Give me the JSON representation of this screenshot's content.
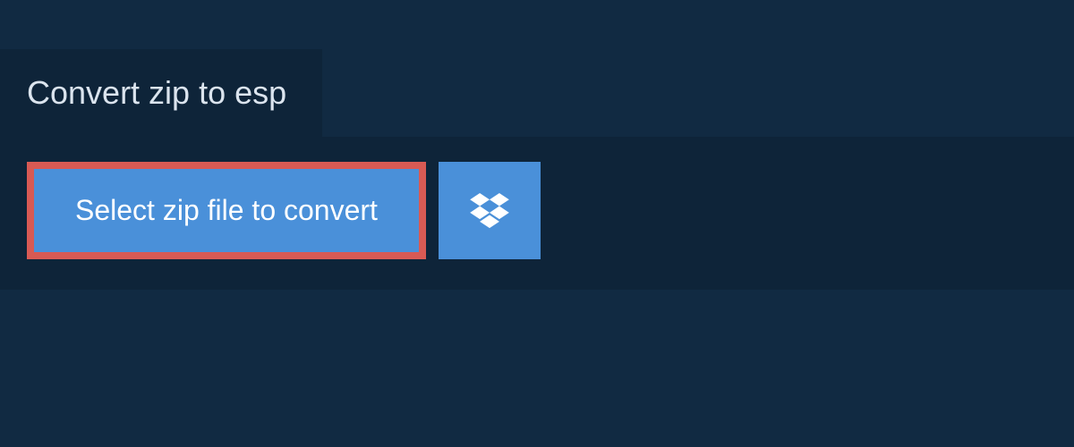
{
  "tab": {
    "title": "Convert zip to esp"
  },
  "actions": {
    "select_file_label": "Select zip file to convert"
  }
}
